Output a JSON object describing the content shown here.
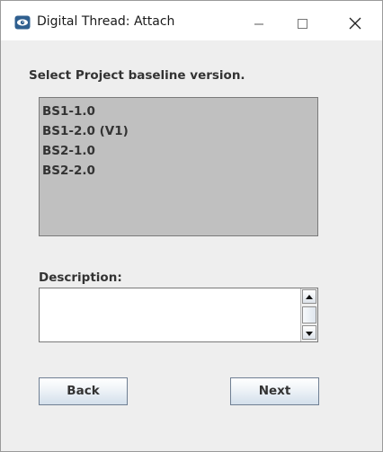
{
  "window": {
    "title": "Digital Thread: Attach",
    "app_icon": "eye-icon",
    "controls": {
      "minimize_icon": "minimize-icon",
      "maximize_icon": "maximize-icon",
      "close_icon": "close-icon"
    }
  },
  "dialog": {
    "heading": "Select Project baseline version.",
    "baselines": [
      "BS1-1.0",
      "BS1-2.0 (V1)",
      "BS2-1.0",
      "BS2-2.0"
    ],
    "description": {
      "label": "Description:",
      "value": "",
      "scroll_up_icon": "arrow-up-icon",
      "scroll_down_icon": "arrow-down-icon"
    },
    "buttons": {
      "back": "Back",
      "next": "Next"
    }
  },
  "colors": {
    "window_bg": "#eeeeee",
    "titlebar_bg": "#ffffff",
    "list_bg": "#c0c0c0",
    "text": "#333333",
    "app_icon": "#2f5f8f"
  }
}
